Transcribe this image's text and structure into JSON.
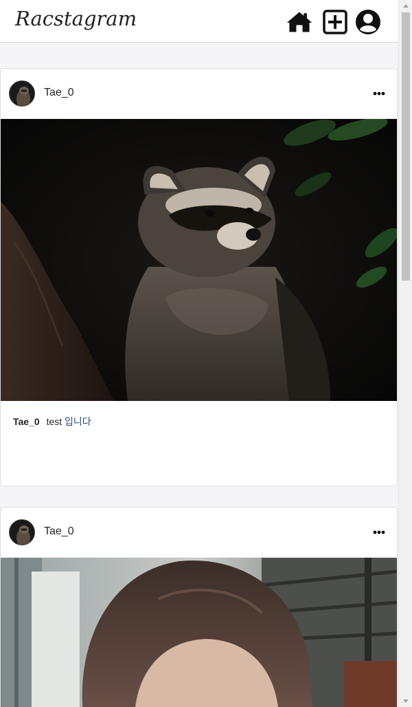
{
  "navbar": {
    "logo": "Racstagram",
    "icons": [
      "home-icon",
      "add-post-icon",
      "profile-icon"
    ]
  },
  "posts": [
    {
      "username": "Tae_0",
      "image": "raccoon photo",
      "caption_user": "Tae_0",
      "caption_text": "test",
      "caption_ko": "입니다"
    },
    {
      "username": "Tae_0",
      "image": "person photo"
    }
  ],
  "colors": {
    "background": "#f5f5f7",
    "card": "#ffffff",
    "border": "#dbdbdb",
    "text": "#262626"
  }
}
